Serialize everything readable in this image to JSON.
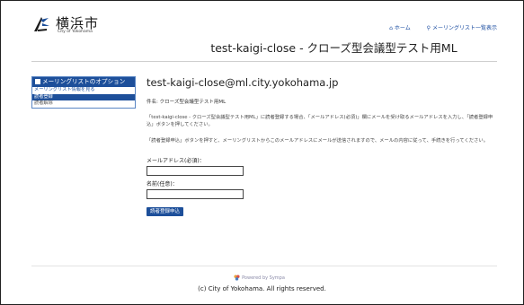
{
  "header": {
    "logo_title": "横浜市",
    "logo_sub": "City of Yokohama",
    "link_home": "ホーム",
    "link_list": "メーリングリスト一覧表示"
  },
  "page_title": "test-kaigi-close - クローズ型会議型テスト用ML",
  "sidebar": {
    "title": "メーリングリストのオプション",
    "items": [
      {
        "label": "メーリングリスト情報を見る"
      },
      {
        "label": "読者登録"
      },
      {
        "label": "読者解除"
      }
    ]
  },
  "main": {
    "email_title": "test-kaigi-close@ml.city.yokohama.jp",
    "subject": "件名: クローズ型会議型テスト用ML",
    "para1": "「test-kaigi-close - クローズ型会議型テスト用ML」に読者登録する場合、「メールアドレス(必須)」欄にメールを受け取るメールアドレスを入力し、「読者登録申込」ボタンを押してください。",
    "para2": "「読者登録申込」ボタンを押すと、メーリングリストからこのメールアドレスにメールが送信されますので、メールの内容に従って、手続きを行ってください。",
    "email_label": "メールアドレス(必須)：",
    "name_label": "名前(任意)：",
    "email_value": "",
    "name_value": "",
    "submit_label": "読者登録申込"
  },
  "footer": {
    "powered": "Powered by Sympa",
    "copyright": "(c) City of Yokohama. All rights reserved."
  },
  "colors": {
    "accent": "#1d4f9a",
    "link": "#1a4ca0"
  }
}
